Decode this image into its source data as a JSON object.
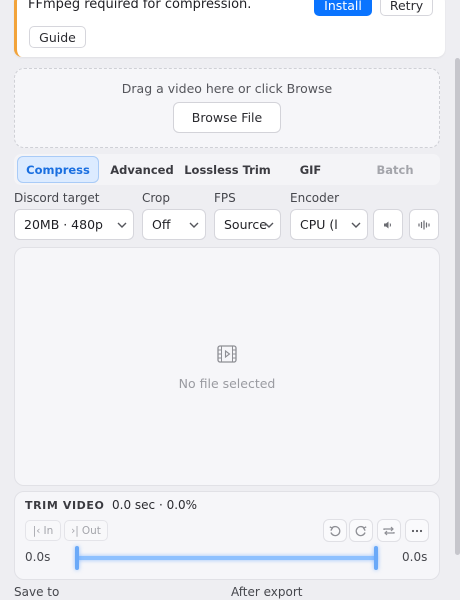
{
  "banner": {
    "message": "FFmpeg required for compression.",
    "install_label": "Install",
    "retry_label": "Retry",
    "guide_label": "Guide",
    "accent_color": "#f2a33a"
  },
  "dropzone": {
    "hint": "Drag a video here or click Browse",
    "browse_label": "Browse File"
  },
  "tabs": [
    {
      "label": "Compress",
      "state": "active"
    },
    {
      "label": "Advanced",
      "state": "normal"
    },
    {
      "label": "Lossless Trim",
      "state": "normal"
    },
    {
      "label": "GIF",
      "state": "normal"
    },
    {
      "label": "Batch",
      "state": "disabled"
    }
  ],
  "options": {
    "discord_target": {
      "label": "Discord target",
      "value": "20MB · 480p"
    },
    "crop": {
      "label": "Crop",
      "value": "Off"
    },
    "fps": {
      "label": "FPS",
      "value": "Source"
    },
    "encoder": {
      "label": "Encoder",
      "value": "CPU (l"
    },
    "audio_icon": "speaker-icon",
    "waveform_icon": "waveform-icon"
  },
  "preview": {
    "icon": "video-file-icon",
    "empty_text": "No file selected"
  },
  "trim": {
    "title": "TRIM VIDEO",
    "info": "0.0 sec · 0.0%",
    "in_label": "In",
    "out_label": "Out",
    "start_time": "0.0s",
    "end_time": "0.0s",
    "accent_color": "#8ec1ff"
  },
  "footer": {
    "save_to_label": "Save to",
    "after_export_label": "After export"
  },
  "colors": {
    "primary": "#0a74ff",
    "active_tab_bg": "#dcebff",
    "active_tab_text": "#1a6fe0"
  }
}
